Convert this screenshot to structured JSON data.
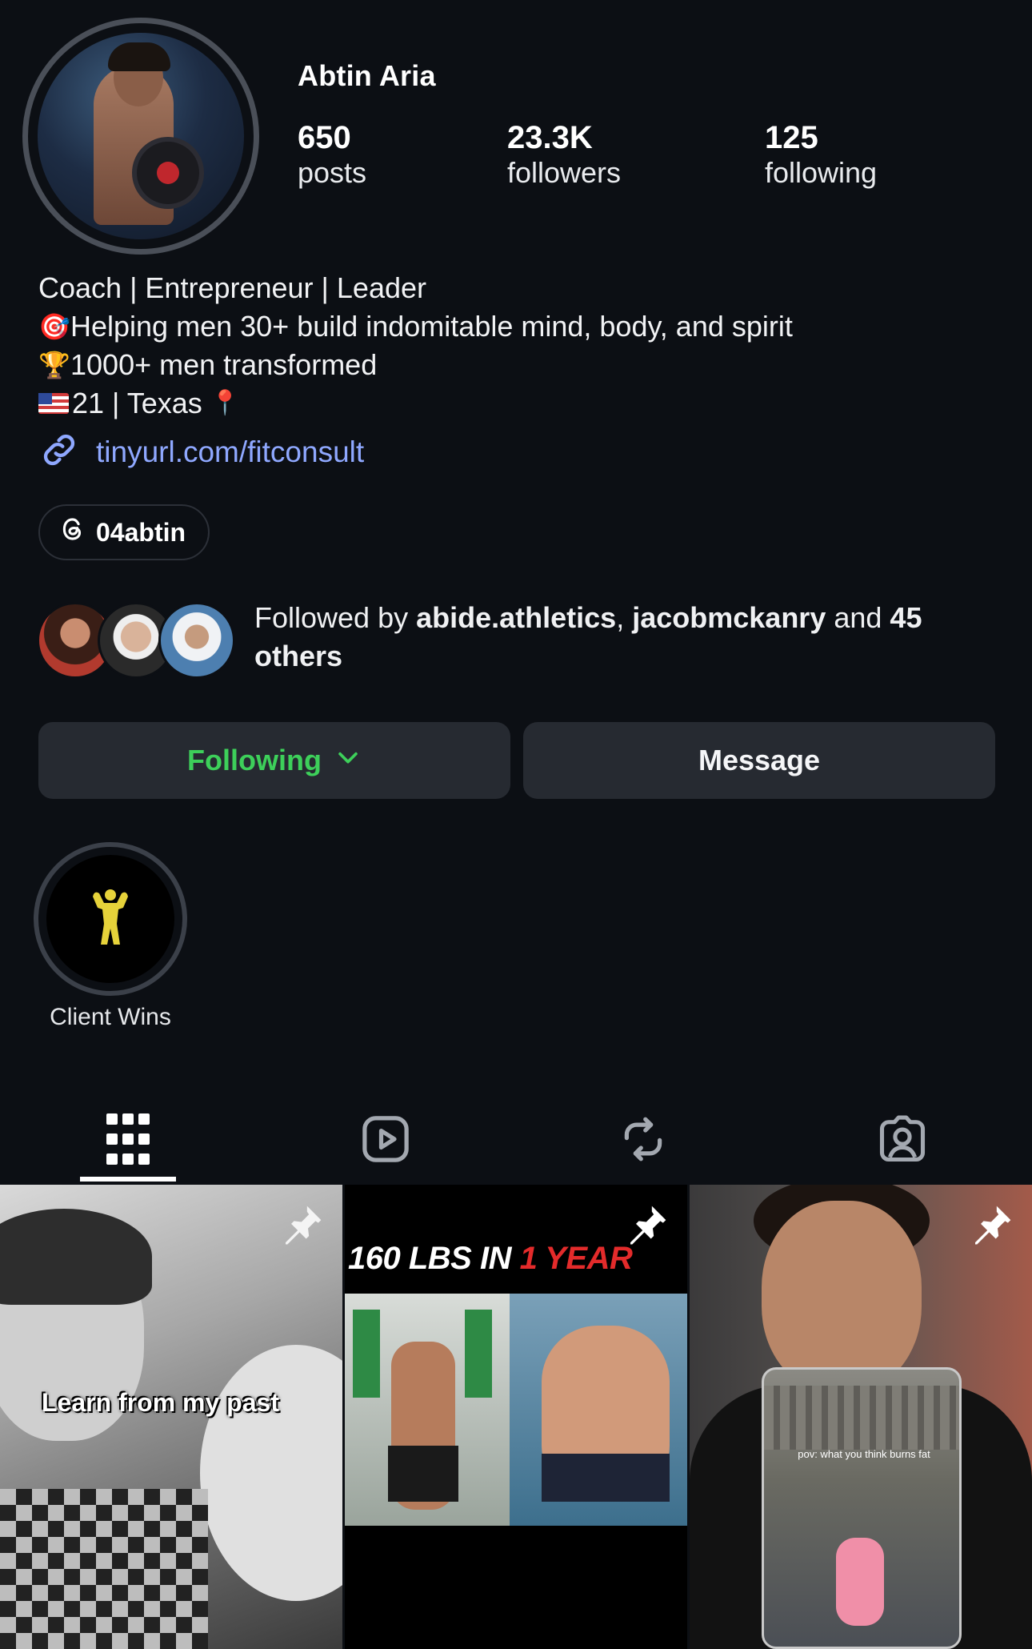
{
  "profile": {
    "name": "Abtin Aria",
    "stats": [
      {
        "value": "650",
        "label": "posts"
      },
      {
        "value": "23.3K",
        "label": "followers"
      },
      {
        "value": "125",
        "label": "following"
      }
    ],
    "bio": [
      {
        "text": "Coach | Entrepreneur | Leader",
        "emoji": ""
      },
      {
        "text": "Helping men 30+ build indomitable mind, body, and spirit",
        "emoji": "🎯"
      },
      {
        "text": "1000+ men transformed",
        "emoji": "🏆"
      },
      {
        "text": "21 | Texas ",
        "emoji": "flag-us",
        "suffix": "📍"
      }
    ],
    "link": "tinyurl.com/fitconsult",
    "threads_handle": "04abtin"
  },
  "followed_by": {
    "prefix": "Followed by ",
    "user1": "abide.athletics",
    "separator": ", ",
    "user2": "jacobmckanry",
    "and_text": " and ",
    "count": "45",
    "others": "others"
  },
  "actions": {
    "following_label": "Following",
    "message_label": "Message"
  },
  "highlights": [
    {
      "label": "Client Wins",
      "icon": "flexing-man-icon"
    }
  ],
  "tabs": [
    {
      "name": "grid",
      "icon": "grid-icon",
      "active": true
    },
    {
      "name": "reels",
      "icon": "play-icon",
      "active": false
    },
    {
      "name": "reposts",
      "icon": "repost-icon",
      "active": false
    },
    {
      "name": "tagged",
      "icon": "tagged-icon",
      "active": false
    }
  ],
  "posts": [
    {
      "caption": "Learn from my past",
      "pinned": true
    },
    {
      "title_white": "160 LBS IN ",
      "title_red": "1 YEAR",
      "pinned": true
    },
    {
      "overlay": "pov: what you think burns fat",
      "pinned": true
    }
  ],
  "colors": {
    "background": "#0c0f14",
    "button_bg": "#262a31",
    "following_green": "#3dd05a",
    "link_blue": "#8fa8ff"
  }
}
